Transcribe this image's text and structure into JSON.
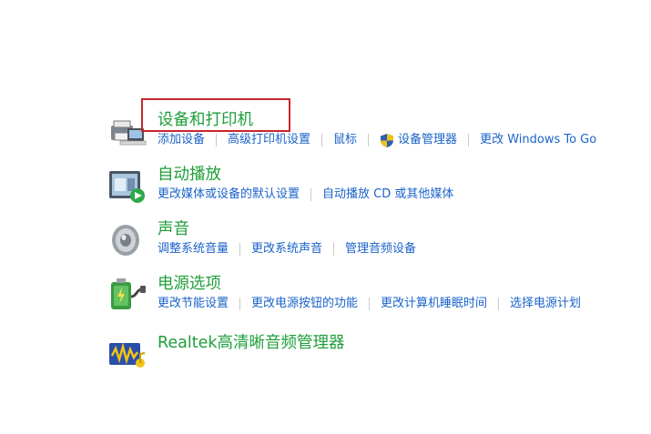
{
  "categories": [
    {
      "title": "设备和打印机",
      "links": [
        "添加设备",
        "高级打印机设置",
        "鼠标",
        "设备管理器",
        "更改 Windows To Go"
      ]
    },
    {
      "title": "自动播放",
      "links": [
        "更改媒体或设备的默认设置",
        "自动播放 CD 或其他媒体"
      ]
    },
    {
      "title": "声音",
      "links": [
        "调整系统音量",
        "更改系统声音",
        "管理音频设备"
      ]
    },
    {
      "title": "电源选项",
      "links": [
        "更改节能设置",
        "更改电源按钮的功能",
        "更改计算机睡眠时间",
        "选择电源计划"
      ]
    },
    {
      "title": "Realtek高清晰音频管理器",
      "links": []
    }
  ],
  "colors": {
    "title_green": "#1e9e3a",
    "link_blue": "#1a63c9",
    "highlight_red": "#c8262a"
  }
}
